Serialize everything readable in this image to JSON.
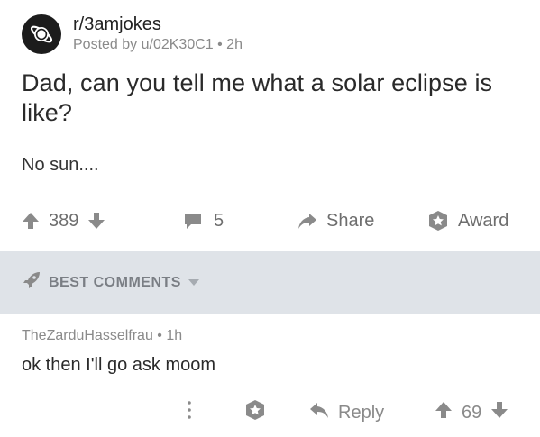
{
  "post": {
    "subreddit": "r/3amjokes",
    "posted_by": "Posted by u/02K30C1",
    "age": "2h",
    "title": "Dad, can you tell me what a solar eclipse is like?",
    "body": "No sun...."
  },
  "actions": {
    "score": "389",
    "comments": "5",
    "share_label": "Share",
    "award_label": "Award"
  },
  "comments_section": {
    "sort_label": "BEST COMMENTS"
  },
  "comment": {
    "author": "TheZarduHasselfrau",
    "age": "1h",
    "body": "ok then I'll go ask moom",
    "reply_label": "Reply",
    "score": "69"
  },
  "icons": {
    "subreddit": "planet-icon",
    "upvote": "upvote-arrow-icon",
    "downvote": "downvote-arrow-icon",
    "comments": "speech-bubble-icon",
    "share": "share-arrow-icon",
    "award": "award-badge-icon",
    "best": "rocket-icon",
    "sort": "caret-down-icon",
    "more": "vertical-dots-icon",
    "reply": "reply-arrow-icon"
  },
  "colors": {
    "icon_gray": "#8a8a8a",
    "best_bar_bg": "#dfe3e8",
    "text": "#222222"
  }
}
